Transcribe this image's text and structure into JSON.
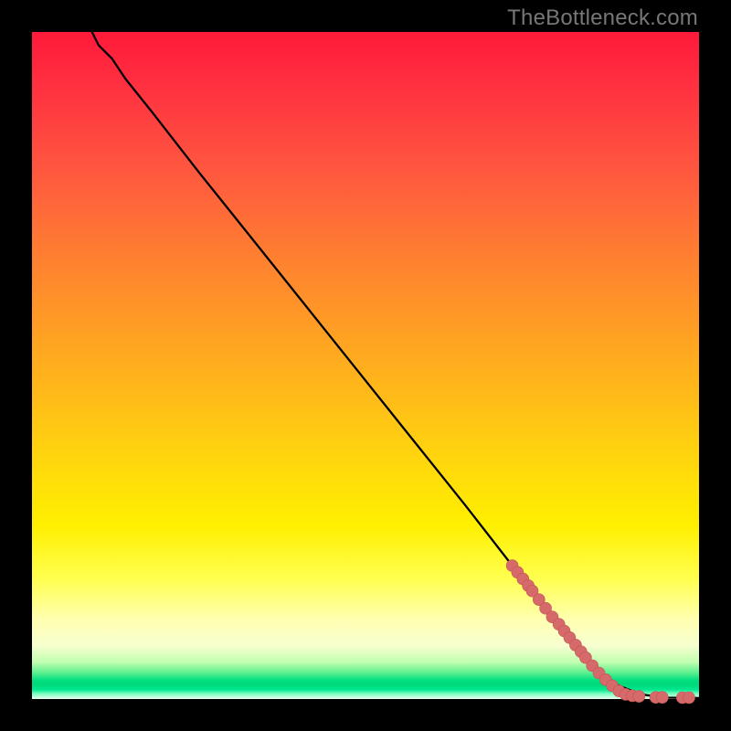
{
  "watermark": {
    "text": "TheBottleneck.com"
  },
  "colors": {
    "curve": "#000000",
    "marker_fill": "#d66a6a",
    "marker_stroke": "#c25454"
  },
  "chart_data": {
    "type": "line",
    "title": "",
    "xlabel": "",
    "ylabel": "",
    "xlim": [
      0,
      100
    ],
    "ylim": [
      0,
      100
    ],
    "grid": false,
    "legend": false,
    "series": [
      {
        "name": "curve",
        "x": [
          9,
          10,
          12,
          14,
          18,
          25,
          35,
          45,
          55,
          65,
          72,
          78,
          82,
          85,
          88,
          90,
          92,
          95,
          100
        ],
        "y": [
          100,
          98,
          96,
          93,
          88,
          79,
          66.5,
          54,
          41.5,
          29,
          20,
          12,
          7,
          4,
          2,
          1.2,
          0.6,
          0.2,
          0.15
        ]
      }
    ],
    "markers": [
      {
        "x": 72.0,
        "y": 20.0
      },
      {
        "x": 72.8,
        "y": 19.0
      },
      {
        "x": 73.6,
        "y": 18.0
      },
      {
        "x": 74.4,
        "y": 17.0
      },
      {
        "x": 75.0,
        "y": 16.2
      },
      {
        "x": 76.0,
        "y": 14.9
      },
      {
        "x": 77.0,
        "y": 13.6
      },
      {
        "x": 78.0,
        "y": 12.3
      },
      {
        "x": 79.0,
        "y": 11.2
      },
      {
        "x": 79.8,
        "y": 10.2
      },
      {
        "x": 80.6,
        "y": 9.2
      },
      {
        "x": 81.5,
        "y": 8.1
      },
      {
        "x": 82.3,
        "y": 7.1
      },
      {
        "x": 83.0,
        "y": 6.2
      },
      {
        "x": 84.0,
        "y": 5.0
      },
      {
        "x": 85.0,
        "y": 3.9
      },
      {
        "x": 86.0,
        "y": 2.9
      },
      {
        "x": 87.0,
        "y": 2.0
      },
      {
        "x": 88.0,
        "y": 1.2
      },
      {
        "x": 89.0,
        "y": 0.7
      },
      {
        "x": 90.0,
        "y": 0.5
      },
      {
        "x": 91.0,
        "y": 0.4
      },
      {
        "x": 93.5,
        "y": 0.25
      },
      {
        "x": 94.5,
        "y": 0.25
      },
      {
        "x": 97.5,
        "y": 0.2
      },
      {
        "x": 98.5,
        "y": 0.2
      }
    ]
  }
}
